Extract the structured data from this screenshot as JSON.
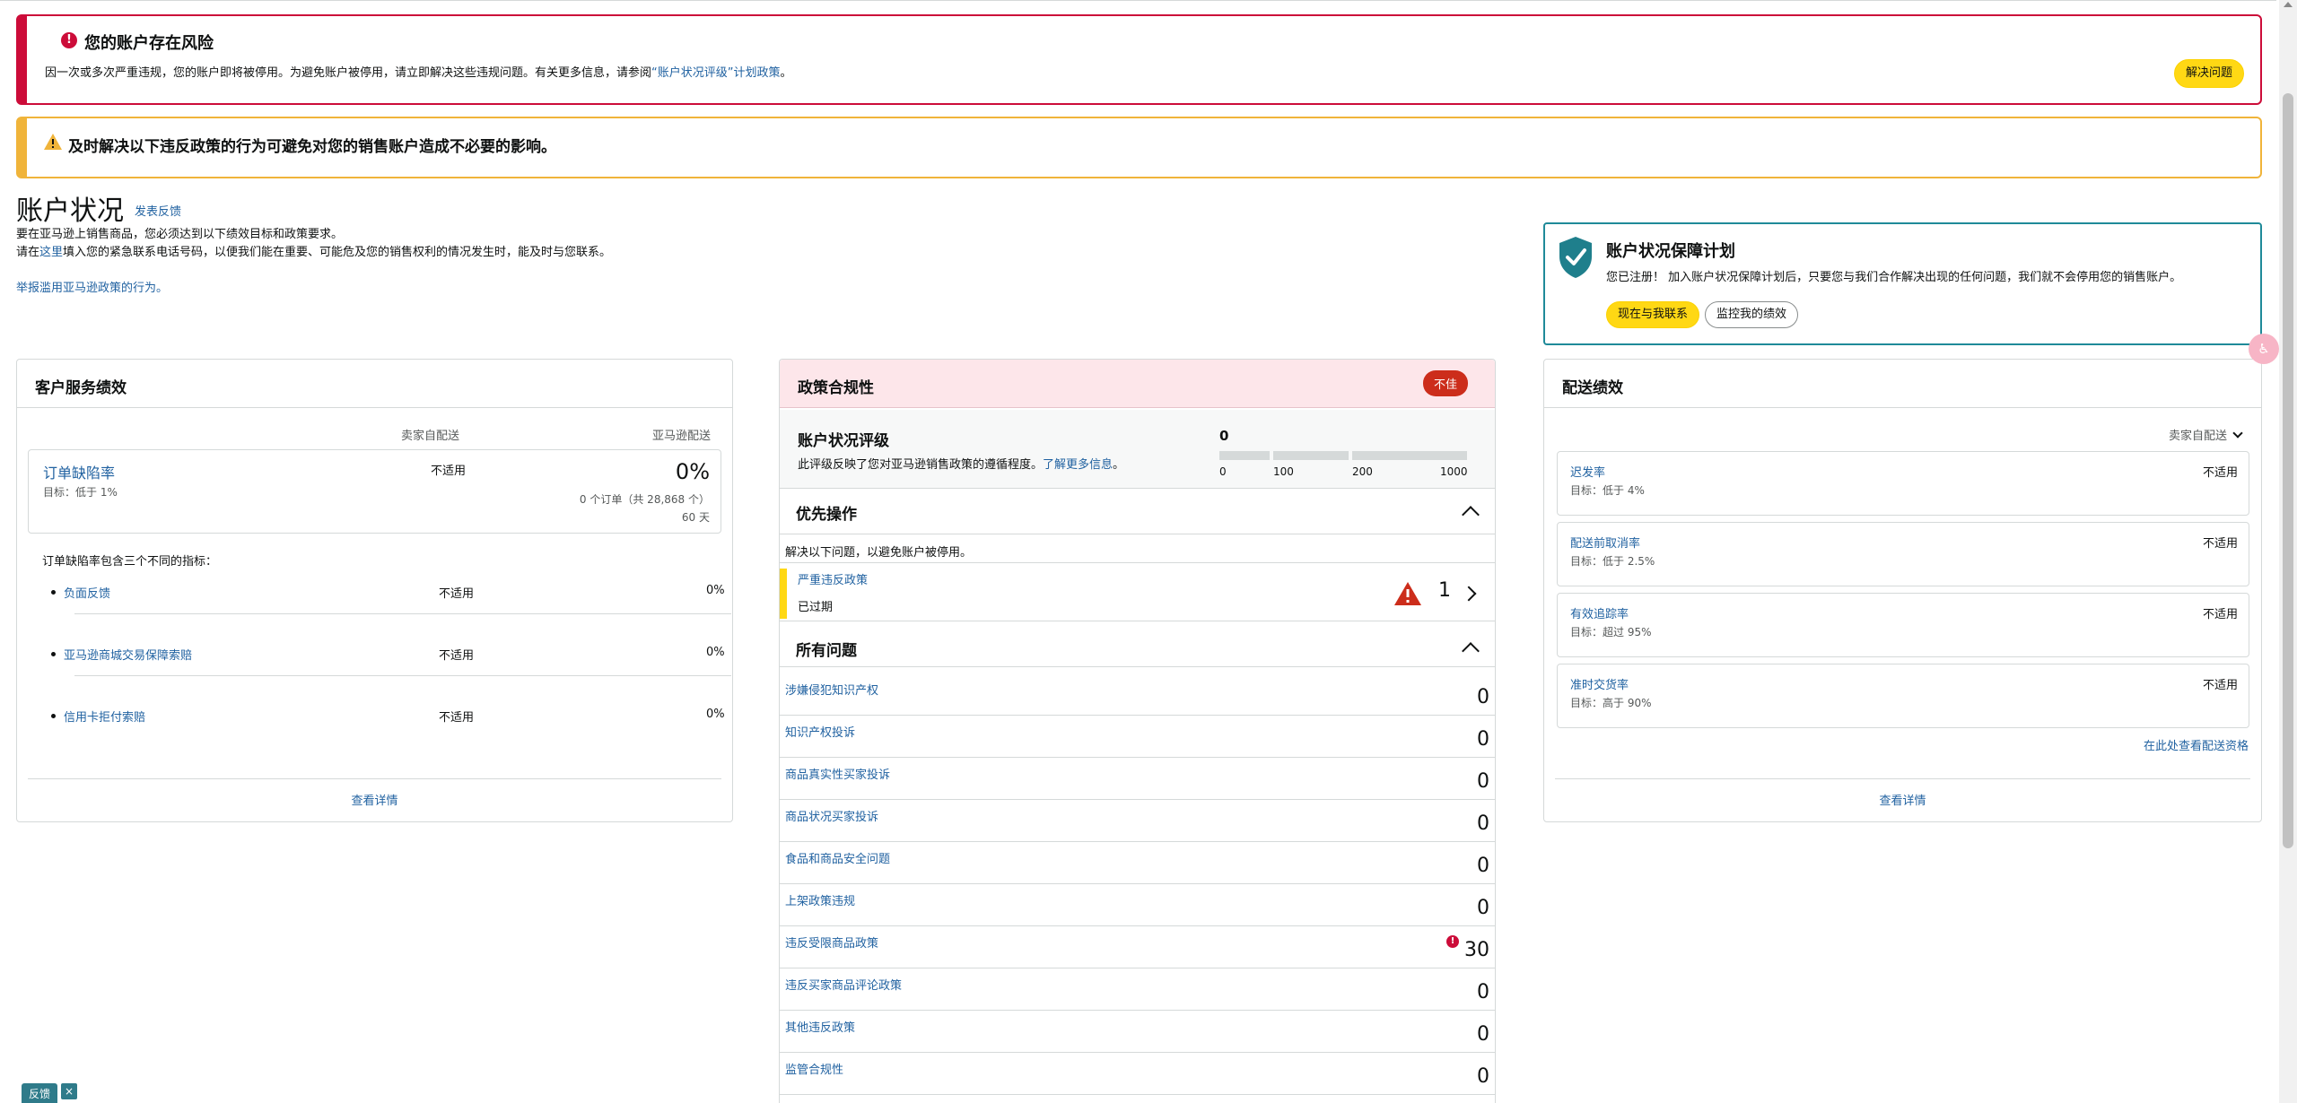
{
  "alerts": {
    "error_title": "您的账户存在风险",
    "error_text_1": "因一次或多次严重违规，您的账户即将被停用。为避免账户被停用，请立即解决这些违规问题。有关更多信息，请参阅",
    "error_link": "“账户状况评级”计划政策",
    "error_text_2": "。",
    "resolve_button": "解决问题",
    "warning_title": "及时解决以下违反政策的行为可避免对您的销售账户造成不必要的影响。"
  },
  "header": {
    "title": "账户状况",
    "feedback_link": "发表反馈",
    "intro_1": "要在亚马逊上销售商品，您必须达到以下绩效目标和政策要求。",
    "intro_2_prefix": "请在",
    "intro_2_link": "这里",
    "intro_2_suffix": "填入您的紧急联系电话号码，以便我们能在重要、可能危及您的销售权利的情况发生时，能及时与您联系。",
    "report_link": "举报滥用亚马逊政策的行为。"
  },
  "protection": {
    "title": "账户状况保障计划",
    "text": "您已注册！ 加入账户状况保障计划后，只要您与我们合作解决出现的任何问题，我们就不会停用您的销售账户。",
    "contact_button": "现在与我联系",
    "monitor_button": "监控我的绩效"
  },
  "customer_service": {
    "title": "客户服务绩效",
    "col_seller": "卖家自配送",
    "col_amazon": "亚马逊配送",
    "odr_name": "订单缺陷率",
    "odr_target": "目标：低于 1%",
    "odr_seller": "不适用",
    "odr_pct": "0%",
    "odr_orders": "0 个订单（共 28,868 个）",
    "odr_days": "60 天",
    "sub_intro": "订单缺陷率包含三个不同的指标：",
    "metrics": [
      {
        "name": "负面反馈",
        "seller": "不适用",
        "amazon": "0%"
      },
      {
        "name": "亚马逊商城交易保障索赔",
        "seller": "不适用",
        "amazon": "0%"
      },
      {
        "name": "信用卡拒付索赔",
        "seller": "不适用",
        "amazon": "0%"
      }
    ],
    "details_link": "查看详情"
  },
  "policy": {
    "title": "政策合规性",
    "badge": "不佳",
    "ahr_title": "账户状况评级",
    "ahr_desc_prefix": "此评级反映了您对亚马逊销售政策的遵循程度。",
    "ahr_desc_link": "了解更多信息",
    "ahr_desc_suffix": "。",
    "ahr_score": "0",
    "ahr_ticks": [
      "0",
      "100",
      "200",
      "1000"
    ],
    "priority_title": "优先操作",
    "priority_intro": "解决以下问题，以避免账户被停用。",
    "priority_item_name": "严重违反政策",
    "priority_item_status": "已过期",
    "priority_item_count": "1",
    "all_title": "所有问题",
    "issues": [
      {
        "name": "涉嫌侵犯知识产权",
        "count": "0"
      },
      {
        "name": "知识产权投诉",
        "count": "0"
      },
      {
        "name": "商品真实性买家投诉",
        "count": "0"
      },
      {
        "name": "商品状况买家投诉",
        "count": "0"
      },
      {
        "name": "食品和商品安全问题",
        "count": "0"
      },
      {
        "name": "上架政策违规",
        "count": "0"
      },
      {
        "name": "违反受限商品政策",
        "count": "30"
      },
      {
        "name": "违反买家商品评论政策",
        "count": "0"
      },
      {
        "name": "其他违反政策",
        "count": "0"
      },
      {
        "name": "监管合规性",
        "count": "0"
      }
    ]
  },
  "delivery": {
    "title": "配送绩效",
    "filter": "卖家自配送",
    "metrics": [
      {
        "name": "迟发率",
        "target": "目标：低于 4%",
        "value": "不适用"
      },
      {
        "name": "配送前取消率",
        "target": "目标：低于 2.5%",
        "value": "不适用"
      },
      {
        "name": "有效追踪率",
        "target": "目标：超过 95%",
        "value": "不适用"
      },
      {
        "name": "准时交货率",
        "target": "目标：高于 90%",
        "value": "不适用"
      }
    ],
    "eligibility_link": "在此处查看配送资格",
    "details_link": "查看详情"
  },
  "widgets": {
    "feedback_tab": "反馈",
    "feedback_close": "×"
  }
}
